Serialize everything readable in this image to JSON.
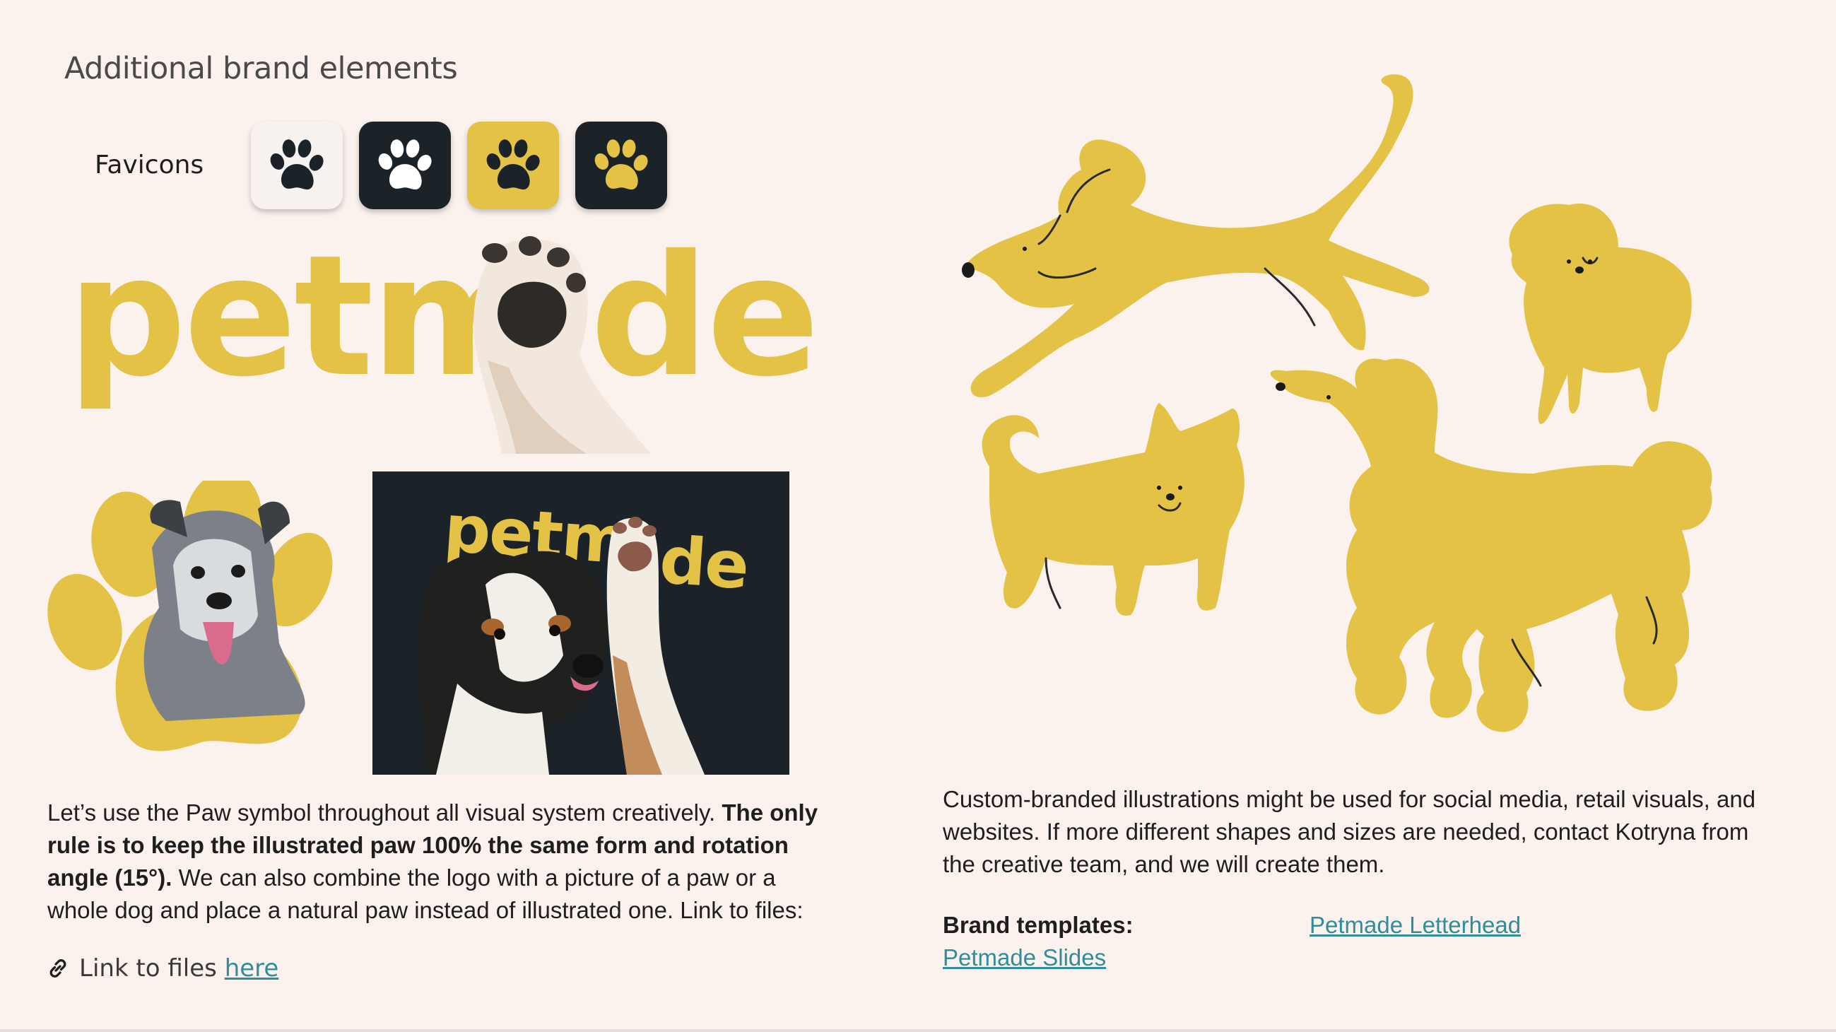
{
  "heading": "Additional brand elements",
  "favicons": {
    "label": "Favicons",
    "items": [
      {
        "name": "light",
        "bg": "#f7f2ef",
        "paw": "#1b2228"
      },
      {
        "name": "dark-white",
        "bg": "#1b2228",
        "paw": "#ffffff"
      },
      {
        "name": "yellow",
        "bg": "#e3c245",
        "paw": "#1b2228"
      },
      {
        "name": "dark-yellow",
        "bg": "#1b2228",
        "paw": "#e3c245"
      }
    ]
  },
  "logo": {
    "wordmark_left": "petm",
    "wordmark_right": "de",
    "card_wordmark_left": "petm",
    "card_wordmark_right": "de"
  },
  "colors": {
    "brand_yellow": "#e3c245",
    "dark": "#1b2228",
    "background": "#fbf2ee",
    "link": "#2f8d9c"
  },
  "left_paragraph": {
    "part1": "Let’s use the Paw symbol throughout all visual system creatively. ",
    "bold": "The only rule is to keep the illustrated paw 100% the same form and rotation angle (15°).",
    "part2": " We can also combine the logo with a picture of a paw or a whole dog and place a natural paw instead of illustrated one. Link to files:"
  },
  "files_link": {
    "icon": "link-icon",
    "text": "Link to files ",
    "link_text": "here"
  },
  "right_paragraph": "Custom-branded illustrations might be used for social media, retail visuals, and websites. If more different shapes and sizes are needed, contact Kotryna from the creative team, and we will create them.",
  "templates": {
    "label": "Brand templates:",
    "letterhead": "Petmade Letterhead",
    "slides": "Petmade Slides"
  }
}
